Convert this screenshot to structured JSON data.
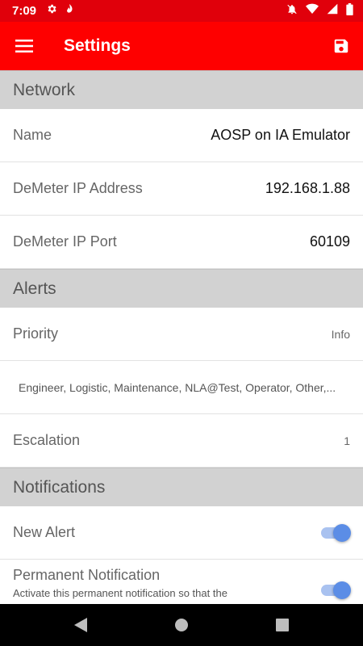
{
  "status_bar": {
    "time": "7:09",
    "left_icons": [
      "gear-icon",
      "notification-app-icon"
    ],
    "right_icons": [
      "do-not-disturb-icon",
      "wifi-icon",
      "signal-icon",
      "battery-icon"
    ]
  },
  "app_bar": {
    "title": "Settings",
    "menu_icon": "hamburger-menu-icon",
    "save_icon": "save-icon"
  },
  "sections": {
    "network": {
      "title": "Network",
      "name_label": "Name",
      "name_value": "AOSP on IA Emulator",
      "ip_label": "DeMeter IP Address",
      "ip_value": "192.168.1.88",
      "port_label": "DeMeter IP Port",
      "port_value": "60109"
    },
    "alerts": {
      "title": "Alerts",
      "priority_label": "Priority",
      "priority_value": "Info",
      "roles_text": "Engineer, Logistic, Maintenance, NLA@Test, Operator, Other,...",
      "escalation_label": "Escalation",
      "escalation_value": "1"
    },
    "notifications": {
      "title": "Notifications",
      "new_alert_label": "New Alert",
      "new_alert_enabled": true,
      "permanent_label": "Permanent Notification",
      "permanent_sub": "Activate this permanent notification so that the",
      "permanent_enabled": true
    }
  },
  "colors": {
    "status_bar": "#e0000b",
    "app_bar": "#fe0000",
    "section_bg": "#d2d2d2",
    "toggle_on": "#5b8de6"
  },
  "nav_bar": {
    "icons": [
      "back-icon",
      "home-icon",
      "recents-icon"
    ]
  }
}
